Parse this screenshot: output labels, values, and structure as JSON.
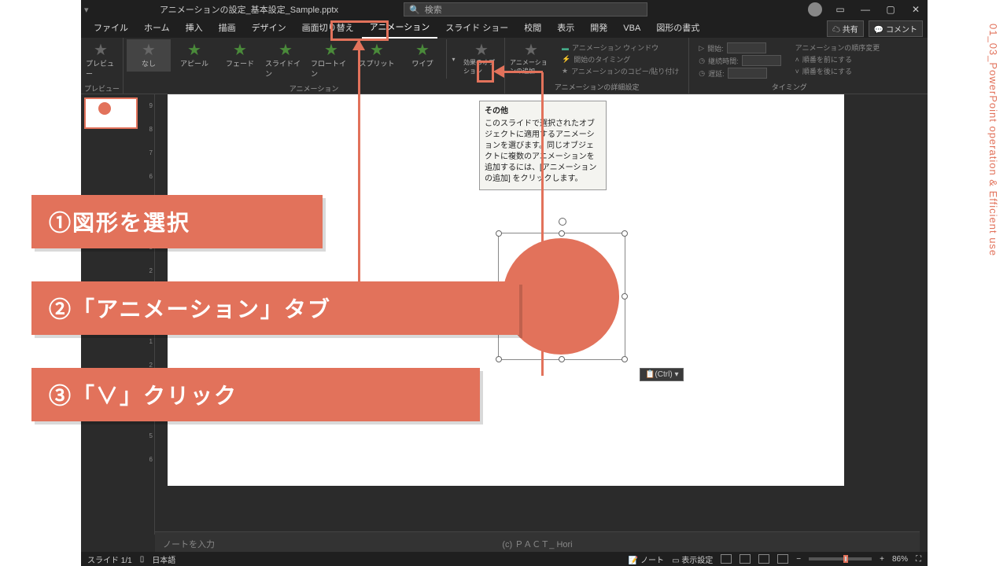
{
  "title": "アニメーションの設定_基本設定_Sample.pptx",
  "search_placeholder": "検索",
  "menu": {
    "file": "ファイル",
    "home": "ホーム",
    "insert": "挿入",
    "draw": "描画",
    "design": "デザイン",
    "transitions": "画面切り替え",
    "animations": "アニメーション",
    "slideshow": "スライド ショー",
    "review": "校閲",
    "view": "表示",
    "developer": "開発",
    "vba": "VBA",
    "format": "図形の書式",
    "share": "共有",
    "comment": "コメント"
  },
  "ribbon": {
    "preview": "プレビュー",
    "preview_group": "プレビュー",
    "anim_none": "なし",
    "anim_appear": "アピール",
    "anim_fade": "フェード",
    "anim_slidein": "スライドイン",
    "anim_floatin": "フロートイン",
    "anim_split": "スプリット",
    "anim_wipe": "ワイプ",
    "anim_group": "アニメーション",
    "effect_opts": "効果のオプション",
    "add_anim": "アニメーションの追加",
    "anim_pane": "アニメーション ウィンドウ",
    "trigger": "開始のタイミング",
    "painter": "アニメーションのコピー/貼り付け",
    "adv_group": "アニメーションの詳細設定",
    "start": "開始:",
    "duration": "継続時間:",
    "delay": "遅延:",
    "order_title": "アニメーションの順序変更",
    "order_earlier": "順番を前にする",
    "order_later": "順番を後にする",
    "timing_group": "タイミング"
  },
  "tooltip": {
    "title": "その他",
    "body": "このスライドで選択されたオブジェクトに適用するアニメーションを選びます。同じオブジェクトに複数のアニメーションを追加するには、[アニメーションの追加] をクリックします。"
  },
  "ctrl_tag": "(Ctrl) ▾",
  "notes_placeholder": "ノートを入力",
  "watermark": "(c) ＰＡＣＴ_ Hori",
  "status": {
    "slide": "スライド 1/1",
    "lang": "日本語",
    "notes": "ノート",
    "display": "表示設定",
    "zoom": "86%"
  },
  "callouts": {
    "c1": "①図形を選択",
    "c2": "②「アニメーション」タブ",
    "c3": "③「∨」クリック"
  },
  "side_text": "01_03_PowerPoint operation & Efficient use"
}
